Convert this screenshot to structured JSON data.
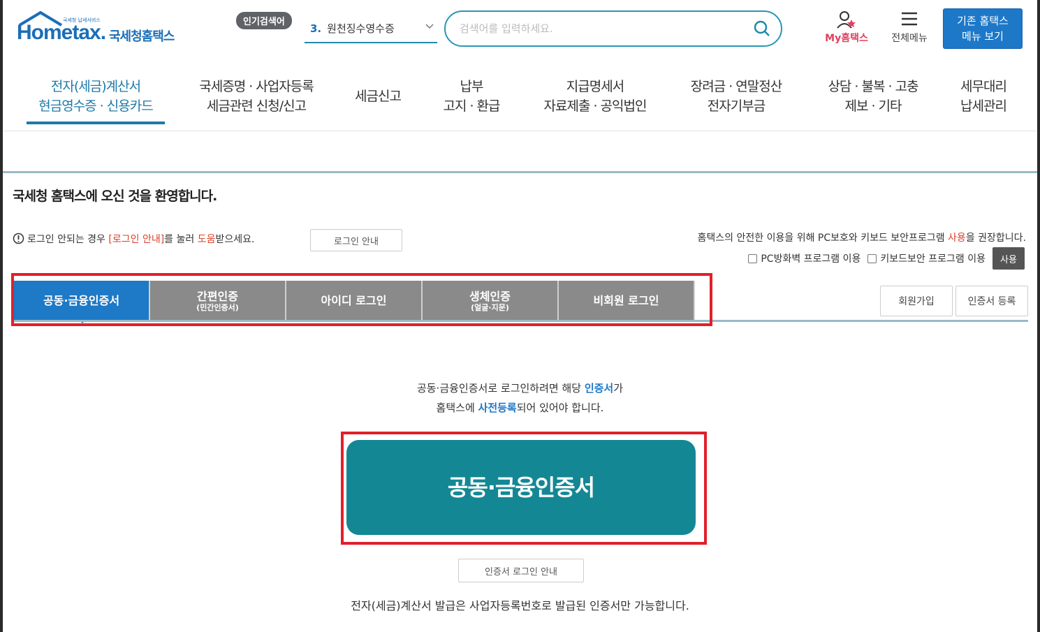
{
  "header": {
    "logo_text": "Hometax.",
    "logo_sub": "국세청홈택스",
    "logo_tiny": "국세청 납세서비스",
    "popular_badge": "인기검색어",
    "popular_rank": "3.",
    "popular_term": "원천징수영수증",
    "search_placeholder": "검색어를 입력하세요.",
    "my_hometax": "My홈택스",
    "all_menu": "전체메뉴",
    "old_menu_line1": "기존 홈택스",
    "old_menu_line2": "메뉴 보기"
  },
  "nav": [
    {
      "line1": "전자(세금)계산서",
      "line2": "현금영수증 · 신용카드"
    },
    {
      "line1": "국세증명 · 사업자등록",
      "line2": "세금관련 신청/신고"
    },
    {
      "line1": "세금신고",
      "line2": ""
    },
    {
      "line1": "납부",
      "line2": "고지 · 환급"
    },
    {
      "line1": "지급명세서",
      "line2": "자료제출 · 공익법인"
    },
    {
      "line1": "장려금 · 연말정산",
      "line2": "전자기부금"
    },
    {
      "line1": "상담 · 불복 · 고충",
      "line2": "제보 · 기타"
    },
    {
      "line1": "세무대리",
      "line2": "납세관리"
    }
  ],
  "welcome": "국세청 홈택스에 오신 것을 환영합니다.",
  "notice": {
    "pre": "로그인 안되는 경우 ",
    "red1": "[로그인 안내]",
    "mid": "를 눌러 ",
    "red2": "도움",
    "post": "받으세요.",
    "button": "로그인 안내"
  },
  "security": {
    "pre": "홈택스의 안전한 이용을 위해 PC보호와 키보드 보안프로그램 ",
    "red": "사용",
    "post": "을 권장합니다.",
    "opt1": "PC방화벽 프로그램 이용",
    "opt2": "키보드보안 프로그램 이용",
    "use_button": "사용"
  },
  "tabs": [
    {
      "label": "공동·금융인증서",
      "sub": ""
    },
    {
      "label": "간편인증",
      "sub": "(민간인증서)"
    },
    {
      "label": "아이디 로그인",
      "sub": ""
    },
    {
      "label": "생체인증",
      "sub": "(얼굴·지문)"
    },
    {
      "label": "비회원 로그인",
      "sub": ""
    }
  ],
  "side_buttons": {
    "join": "회원가입",
    "cert_register": "인증서 등록"
  },
  "body": {
    "desc1_pre": "공동·금융인증서로 로그인하려면 해당 ",
    "desc1_blue": "인증서",
    "desc1_post": "가",
    "desc2_pre": "홈택스에 ",
    "desc2_blue": "사전등록",
    "desc2_post": "되어 있어야 합니다.",
    "main_button": "공동·금융인증서",
    "guide_button": "인증서 로그인 안내",
    "bottom_note": "전자(세금)계산서 발급은 사업자등록번호로 발급된 인증서만 가능합니다."
  },
  "colors": {
    "primary_blue": "#1e79c6",
    "teal": "#138894",
    "highlight_red": "#e0202a"
  }
}
